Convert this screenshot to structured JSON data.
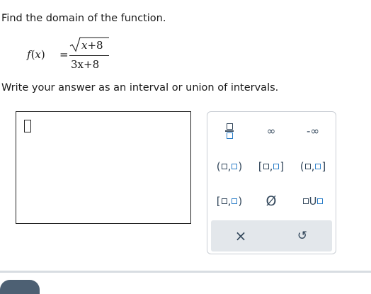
{
  "question": {
    "prompt": "Find the domain of the function.",
    "instruction": "Write your answer as an interval or union of intervals."
  },
  "formula": {
    "fn": "f",
    "var": "x",
    "equals": "=",
    "numerator_rest": "+8",
    "denominator": "3x+8"
  },
  "keypad": {
    "infinity": "∞",
    "neg_infinity": "-∞",
    "empty_set": "Ø",
    "union": "U",
    "clear": "×",
    "undo": "↺",
    "open_paren": "(",
    "close_paren": ")",
    "open_bracket": "[",
    "close_bracket": "]",
    "comma": ","
  }
}
